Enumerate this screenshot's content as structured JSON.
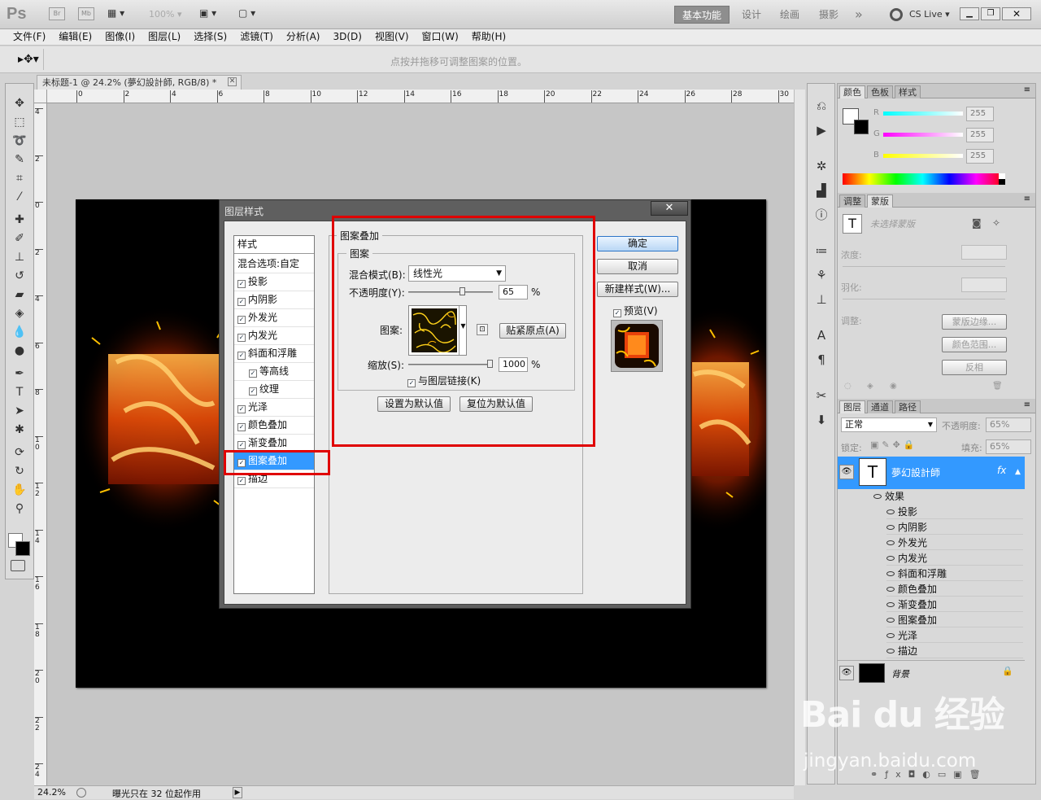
{
  "app": {
    "logo": "Ps",
    "bridge_label": "Br",
    "minibridge_label": "Mb",
    "zoom_value": "100%",
    "workspaces": [
      "基本功能",
      "设计",
      "绘画",
      "摄影"
    ],
    "more_label": "»",
    "cslive_label": "CS Live"
  },
  "menu": [
    "文件(F)",
    "编辑(E)",
    "图像(I)",
    "图层(L)",
    "选择(S)",
    "滤镜(T)",
    "分析(A)",
    "3D(D)",
    "视图(V)",
    "窗口(W)",
    "帮助(H)"
  ],
  "options_hint": "点按并拖移可调整图案的位置。",
  "document": {
    "tab_title": "未标题-1 @ 24.2% (夢幻設計師, RGB/8) *",
    "ruler_top": [
      "0",
      "2",
      "4",
      "6",
      "8",
      "10",
      "12",
      "14",
      "16",
      "18",
      "20",
      "22",
      "24",
      "26",
      "28",
      "30"
    ],
    "ruler_left": [
      "4",
      "2",
      "0",
      "2",
      "4",
      "6",
      "8",
      "1 0",
      "1 2",
      "1 4",
      "1 6",
      "1 8",
      "2 0",
      "2 2",
      "2 4"
    ],
    "zoom": "24.2%",
    "status": "曝光只在 32 位起作用"
  },
  "dialog": {
    "title": "图层样式",
    "styles_header": "样式",
    "blend_options": "混合选项:自定",
    "styles": [
      {
        "label": "投影",
        "checked": true,
        "indent": false
      },
      {
        "label": "内阴影",
        "checked": true,
        "indent": false
      },
      {
        "label": "外发光",
        "checked": true,
        "indent": false
      },
      {
        "label": "内发光",
        "checked": true,
        "indent": false
      },
      {
        "label": "斜面和浮雕",
        "checked": true,
        "indent": false
      },
      {
        "label": "等高线",
        "checked": true,
        "indent": true
      },
      {
        "label": "纹理",
        "checked": true,
        "indent": true
      },
      {
        "label": "光泽",
        "checked": true,
        "indent": false
      },
      {
        "label": "颜色叠加",
        "checked": true,
        "indent": false
      },
      {
        "label": "渐变叠加",
        "checked": true,
        "indent": false
      },
      {
        "label": "图案叠加",
        "checked": true,
        "indent": false,
        "selected": true
      },
      {
        "label": "描边",
        "checked": true,
        "indent": false
      }
    ],
    "section_title": "图案叠加",
    "group_title": "图案",
    "blend_mode_label": "混合模式(B):",
    "blend_mode_value": "线性光",
    "opacity_label": "不透明度(Y):",
    "opacity_value": "65",
    "opacity_fraction": 0.65,
    "pattern_label": "图案:",
    "snap_button": "贴紧原点(A)",
    "scale_label": "缩放(S):",
    "scale_value": "1000",
    "scale_fraction": 1.0,
    "percent": "%",
    "link_label": "与图层链接(K)",
    "set_default": "设置为默认值",
    "reset_default": "复位为默认值",
    "ok": "确定",
    "cancel": "取消",
    "new_style": "新建样式(W)...",
    "preview": "预览(V)"
  },
  "panels": {
    "color_tabs": [
      "颜色",
      "色板",
      "样式"
    ],
    "rgb_labels": [
      "R",
      "G",
      "B"
    ],
    "rgb_values": [
      "255",
      "255",
      "255"
    ],
    "adjust_tabs": [
      "调整",
      "蒙版"
    ],
    "mask_hint": "未选择蒙版",
    "density_label": "浓度:",
    "feather_label": "羽化:",
    "refine_label": "调整:",
    "mask_edge_btn": "蒙版边缘...",
    "color_range_btn": "颜色范围...",
    "invert_btn": "反相",
    "layer_tabs": [
      "图层",
      "通道",
      "路径"
    ],
    "blend_mode": "正常",
    "opacity_label": "不透明度:",
    "opacity_value": "65%",
    "lock_label": "锁定:",
    "fill_label": "填充:",
    "fill_value": "65%",
    "text_layer_name": "夢幻設計師",
    "fx_label": "fx",
    "effects_label": "效果",
    "effects": [
      "投影",
      "内阴影",
      "外发光",
      "内发光",
      "斜面和浮雕",
      "颜色叠加",
      "渐变叠加",
      "图案叠加",
      "光泽",
      "描边"
    ],
    "bg_layer_name": "背景"
  },
  "watermark": {
    "main": "Bai du 经验",
    "url": "jingyan.baidu.com"
  },
  "colors": {
    "selection_blue": "#3399ff",
    "highlight_red": "#e00000",
    "layer_selected": "#3399ff"
  }
}
